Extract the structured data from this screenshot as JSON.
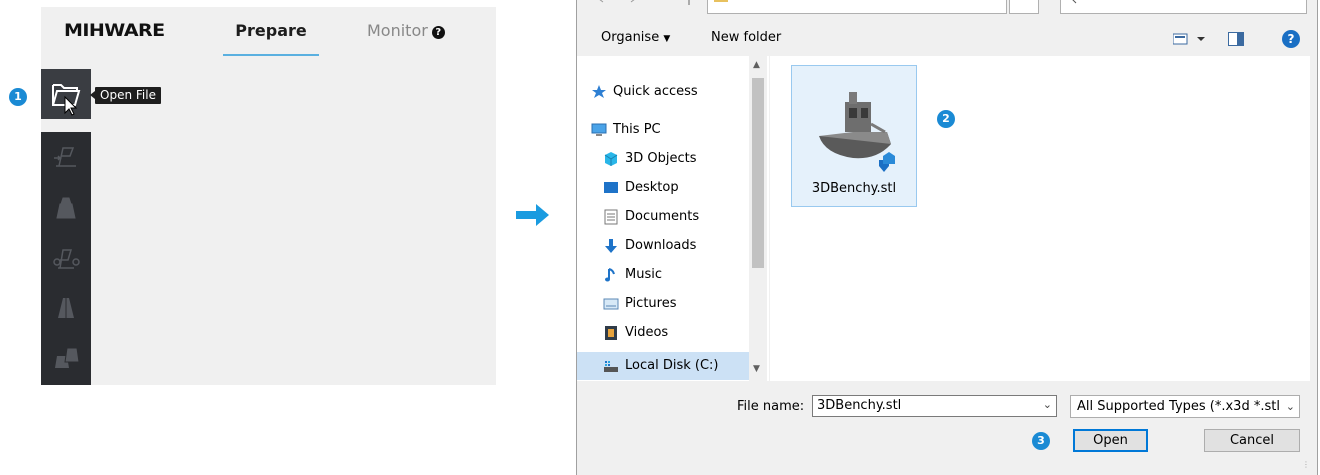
{
  "app": {
    "logo": "MIHWARE",
    "tabs": {
      "prepare": "Prepare",
      "monitor": "Monitor"
    },
    "monitor_help_glyph": "?",
    "tooltip": "Open File",
    "tools": [
      "open-file-icon",
      "slicing-plane-icon",
      "model-icon",
      "transform-icon",
      "support-icon",
      "multi-model-icon"
    ]
  },
  "steps": {
    "one": "1",
    "two": "2",
    "three": "3"
  },
  "dialog": {
    "cmdbar": {
      "organise": "Organise",
      "new_folder": "New folder",
      "help_glyph": "?"
    },
    "nav": {
      "items": [
        {
          "label": "Quick access",
          "icon": "star-icon"
        },
        {
          "label": "This PC",
          "icon": "computer-icon"
        },
        {
          "label": "3D Objects",
          "icon": "cube-icon"
        },
        {
          "label": "Desktop",
          "icon": "desktop-icon"
        },
        {
          "label": "Documents",
          "icon": "document-icon"
        },
        {
          "label": "Downloads",
          "icon": "download-icon"
        },
        {
          "label": "Music",
          "icon": "music-icon"
        },
        {
          "label": "Pictures",
          "icon": "picture-icon"
        },
        {
          "label": "Videos",
          "icon": "video-icon"
        },
        {
          "label": "Local Disk (C:)",
          "icon": "disk-icon"
        }
      ],
      "selected": "Local Disk (C:)"
    },
    "files": [
      {
        "name": "3DBenchy.stl",
        "icon": "stl-boat-icon",
        "selected": true
      }
    ],
    "file_name_label": "File name:",
    "file_name_value": "3DBenchy.stl",
    "file_type": "All Supported Types (*.x3d *.stl",
    "buttons": {
      "open": "Open",
      "cancel": "Cancel"
    }
  },
  "colors": {
    "accent": "#1a8ad4",
    "selection": "#cce1f5",
    "tab_underline": "#5ab0e0",
    "toolbar": "#2a2c30"
  }
}
